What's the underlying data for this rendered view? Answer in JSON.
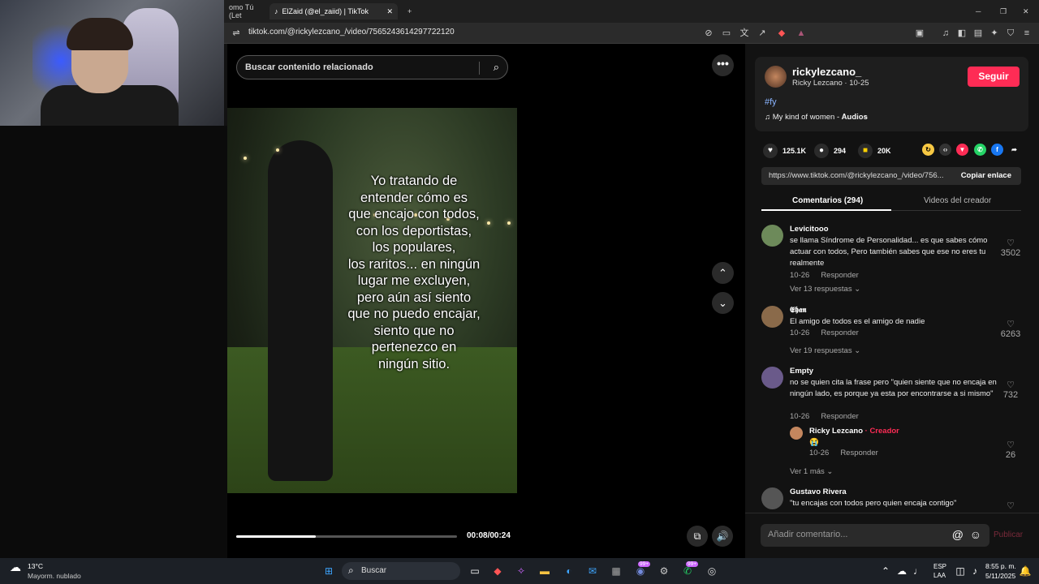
{
  "browser": {
    "tabs": [
      {
        "label": "omo Tú (Let"
      },
      {
        "label": "ElZaid (@el_zaiid) | TikTok"
      }
    ],
    "new_tab": "+",
    "url": "tiktok.com/@rickylezcano_/video/7565243614297722120"
  },
  "video": {
    "search_placeholder": "Buscar contenido relacionado",
    "caption": "Yo tratando de\nentender cómo es\nque encajo con todos,\ncon los deportistas,\nlos populares,\nlos raritos... en ningún\nlugar me excluyen,\npero aún así siento\nque no puedo encajar,\nsiento que no\npertenezco en\nningún sitio.",
    "time": "00:08/00:24",
    "progress": 0.36
  },
  "author": {
    "username": "rickylezcano_",
    "subtitle": "Ricky Lezcano · 10-25",
    "follow": "Seguir",
    "hashtag": "#fy",
    "music": "My kind of women - 𝐀𝐮𝐝𝐢𝐨𝐬"
  },
  "stats": {
    "likes": "125.1K",
    "comments": "294",
    "saves": "20K"
  },
  "link": {
    "url": "https://www.tiktok.com/@rickylezcano_/video/756...",
    "copy": "Copiar enlace"
  },
  "tabs": {
    "comments": "Comentarios (294)",
    "creator_videos": "Videos del creador"
  },
  "comments": [
    {
      "name": "Levicitooo",
      "text": "se llama Síndrome de Personalidad... es que sabes cómo actuar con todos, Pero también sabes que ese no eres tu realmente",
      "date": "10-26",
      "reply": "Responder",
      "likes": "3502",
      "more": "Ver 13 respuestas",
      "color": "#6d8a5a"
    },
    {
      "name": "𝕰𝖍𝖆𝖓",
      "text": "El amigo de todos es el amigo de nadie",
      "date": "10-26",
      "reply": "Responder",
      "likes": "6263",
      "more": "Ver 19 respuestas",
      "color": "#8a6a4a"
    },
    {
      "name": "Empty",
      "text": "no se quien cita la frase pero \"quien siente que no encaja en ningún lado, es porque ya esta por encontrarse a si mismo\"",
      "date": "10-26",
      "reply": "Responder",
      "likes": "732",
      "color": "#6a5a8a"
    },
    {
      "name": "Ricky Lezcano",
      "creator": "· Creador",
      "text": "😭",
      "date": "10-26",
      "reply": "Responder",
      "likes": "26",
      "more": "Ver 1 más",
      "color": "#c4865e"
    },
    {
      "name": "Gustavo Rivera",
      "text": "\"tu encajas con todos pero quien encaja contigo\"",
      "color": "#555"
    }
  ],
  "add_comment": {
    "placeholder": "Añadir comentario...",
    "publish": "Publicar"
  },
  "taskbar": {
    "temp": "13°C",
    "weather": "Mayorm. nublado",
    "search": "Buscar",
    "lang1": "ESP",
    "lang2": "LAA",
    "time": "8:55 p. m.",
    "date": "5/11/2025",
    "badge1": "99+",
    "badge2": "99+"
  }
}
